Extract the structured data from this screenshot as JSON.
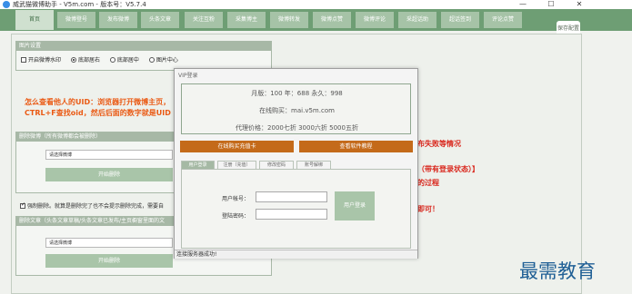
{
  "window": {
    "title": "威武猫微博助手 - V5m.com - 版本号：V5.7.4",
    "minimize": "—",
    "maximize": "☐",
    "close": "✕"
  },
  "tabs": [
    "首页",
    "微博登号",
    "发布微博",
    "头条文章",
    "关注互粉",
    "采集博主",
    "微博转发",
    "微博点赞",
    "微博评论",
    "采超话助",
    "超话签到",
    "评论点赞"
  ],
  "active_tab": 0,
  "save_button": "保存配置",
  "image_settings": {
    "title": "图片设置",
    "watermark_checkbox": "开启微博水印",
    "options": [
      "底部居右",
      "底部居中",
      "图片中心"
    ],
    "selected": 0
  },
  "hint_line1": "怎么查看他人的UID：浏览器打开微博主页，",
  "hint_line2": "CTRL+F查找oid，然后后面的数字就是UID",
  "delete_weibo": {
    "title": "删除微博（所有微博都会被删除）",
    "select_placeholder": "请选择微博",
    "button": "开始删除"
  },
  "force_delete": {
    "checkbox": "强制删除。就算是删除完了也不会提示删除完成，需要自",
    "checked": true
  },
  "delete_article": {
    "title": "删除文章（头条文章草稿/头条文章已发布/主页橱窗里面的文",
    "select_placeholder": "请选择微博",
    "button": "开始删除"
  },
  "right_texts": [
    "布失败等情况",
    "（带有登录状态）】",
    "的过程",
    "即可！"
  ],
  "dialog": {
    "title": "VIP登录",
    "price_line": "月版：100 年：688 永久：998",
    "buy_line": "在线购买：mai.v5m.com",
    "agent_line": "代理价格：2000七折 3000六折 5000五折",
    "buy_button": "在线购买充值卡",
    "tutorial_button": "查看软件教程",
    "tabs": [
      "用户登录",
      "注册（充值）",
      "修改密码",
      "账号解绑"
    ],
    "active_tab": 0,
    "account_label": "用户帐号：",
    "password_label": "登陆密码：",
    "login_button": "用户登录",
    "status": "连接服务器成功!"
  },
  "watermark": "最需教育"
}
